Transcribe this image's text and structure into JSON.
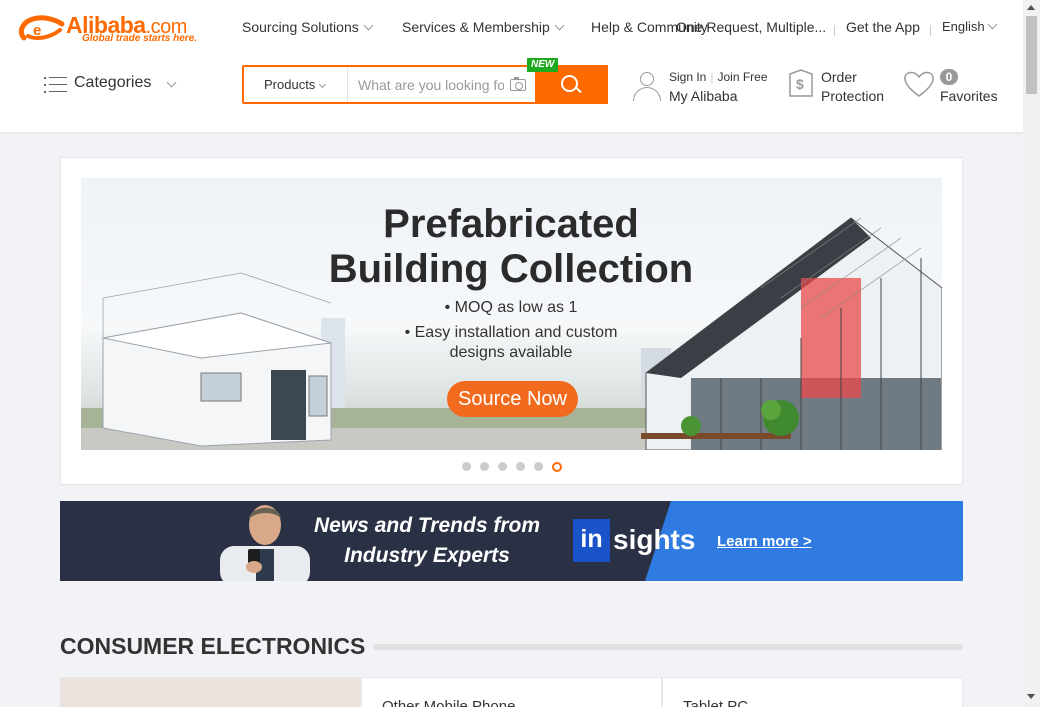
{
  "brand": {
    "name": "Alibaba",
    "suffix": ".com",
    "tagline": "Global trade starts here.",
    "accent": "#ff6a00"
  },
  "topnav": {
    "sourcing": "Sourcing Solutions",
    "services": "Services & Membership",
    "help": "Help & Community",
    "one_request": "One Request, Multiple...",
    "app": "Get the App",
    "language": "English"
  },
  "categories": {
    "label": "Categories"
  },
  "search": {
    "category": "Products",
    "placeholder": "What are you looking for",
    "value": "",
    "new_badge": "NEW"
  },
  "account": {
    "sign_in": "Sign In",
    "join": "Join Free",
    "my": "My Alibaba"
  },
  "order_protection": {
    "line1": "Order",
    "line2": "Protection"
  },
  "favorites": {
    "count": "0",
    "label": "Favorites"
  },
  "banner": {
    "title": "Prefabricated Building Collection",
    "bullet1": "• MOQ as low as 1",
    "bullet2": "• Easy installation and custom designs available",
    "cta": "Source Now",
    "active_slide": 6,
    "slide_count": 6
  },
  "insights": {
    "headline": "News and Trends from Industry Experts",
    "logo_in": "in",
    "logo_rest": "sights",
    "link": "Learn more >"
  },
  "section": {
    "title": "CONSUMER ELECTRONICS",
    "cards": [
      "Other Mobile Phone",
      "Tablet PC"
    ]
  }
}
